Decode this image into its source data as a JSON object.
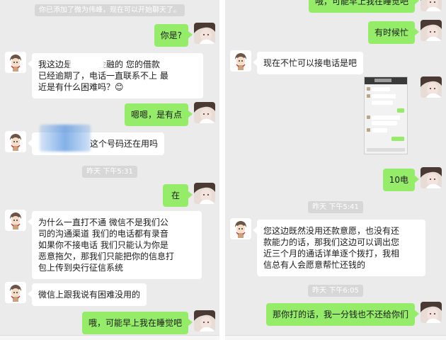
{
  "left_panel": {
    "system_notice": "你已添加了微为伟峰，现在可以开始聊天了。",
    "messages": [
      {
        "side": "out",
        "text": "你是?"
      },
      {
        "side": "in",
        "text": "我这边是　　　金融的 您的借款\n已经逾期了，电话一直联系不上 最\n近是有什么困难吗？😊"
      },
      {
        "side": "out",
        "text": "嗯嗯，是有点"
      },
      {
        "side": "in",
        "text": "这个号码还在用吗"
      },
      {
        "side": "time",
        "text": "昨天 下午5:31"
      },
      {
        "side": "out",
        "text": "在"
      },
      {
        "side": "in",
        "text": "为什么一直打不通 微信不是我们公\n司的沟通渠道  我们的电话都有录音\n如果你不接电话  我们只能认为你是\n恶意拖欠，那我们只能把你的信息打\n包上传到央行征信系统"
      },
      {
        "side": "in",
        "text": "微信上跟我说有困难没用的"
      },
      {
        "side": "out",
        "text": "哦，可能早上我在睡觉吧"
      }
    ]
  },
  "right_panel": {
    "messages": [
      {
        "side": "out",
        "text": "哦，可能早上我在睡觉吧"
      },
      {
        "side": "out",
        "text": "有时候忙"
      },
      {
        "side": "in",
        "text": "现在不忙可以接电话是吧"
      },
      {
        "side": "out",
        "text": "10电"
      },
      {
        "side": "time",
        "text": "昨天 下午5:41"
      },
      {
        "side": "in",
        "text": "您这边既然没用还款意愿，也没有还\n款能力的话，那我们这边可以调出您\n近三个月的通话详单逐个拨打，我相\n信总有人会愿意帮忙还钱的"
      },
      {
        "side": "time",
        "text": "昨天 下午6:05"
      },
      {
        "side": "out",
        "text": "那你打的话，我一分钱也不还给你们"
      }
    ]
  },
  "colors": {
    "chat_background": "#ebebeb",
    "outgoing_bubble": "#95ec69",
    "incoming_bubble": "#ffffff",
    "system_pill": "#d7d7d7"
  },
  "icons": {
    "incoming_avatar": "cartoon-boy-avatar-icon",
    "outgoing_avatar": "girl-photo-avatar-icon",
    "embedded_image": "chat-screenshot-thumbnail"
  }
}
